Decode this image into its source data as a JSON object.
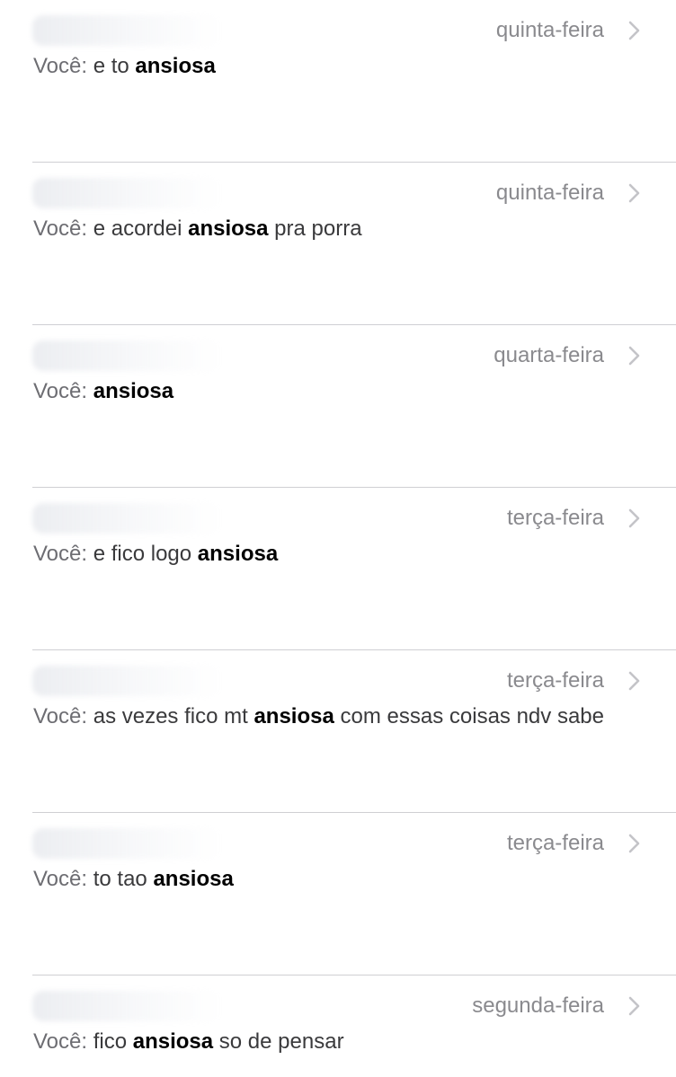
{
  "you_label": "Você:",
  "results": [
    {
      "date": "quinta-feira",
      "before": "e to ",
      "keyword": "ansiosa",
      "after": ""
    },
    {
      "date": "quinta-feira",
      "before": "e acordei ",
      "keyword": "ansiosa",
      "after": " pra porra"
    },
    {
      "date": "quarta-feira",
      "before": "",
      "keyword": "ansiosa",
      "after": ""
    },
    {
      "date": "terça-feira",
      "before": "e fico logo ",
      "keyword": "ansiosa",
      "after": ""
    },
    {
      "date": "terça-feira",
      "before": "as vezes fico mt ",
      "keyword": "ansiosa",
      "after": " com essas coisas ndv sabe"
    },
    {
      "date": "terça-feira",
      "before": "to tao ",
      "keyword": "ansiosa",
      "after": ""
    },
    {
      "date": "segunda-feira",
      "before": "fico ",
      "keyword": "ansiosa",
      "after": " so de pensar"
    }
  ],
  "colors": {
    "date_text": "#8a8a8e",
    "you_label": "#6d6d72",
    "keyword": "#000000",
    "divider": "#cfcfd3"
  },
  "icons": {
    "row_disclosure": "chevron-right-icon"
  }
}
